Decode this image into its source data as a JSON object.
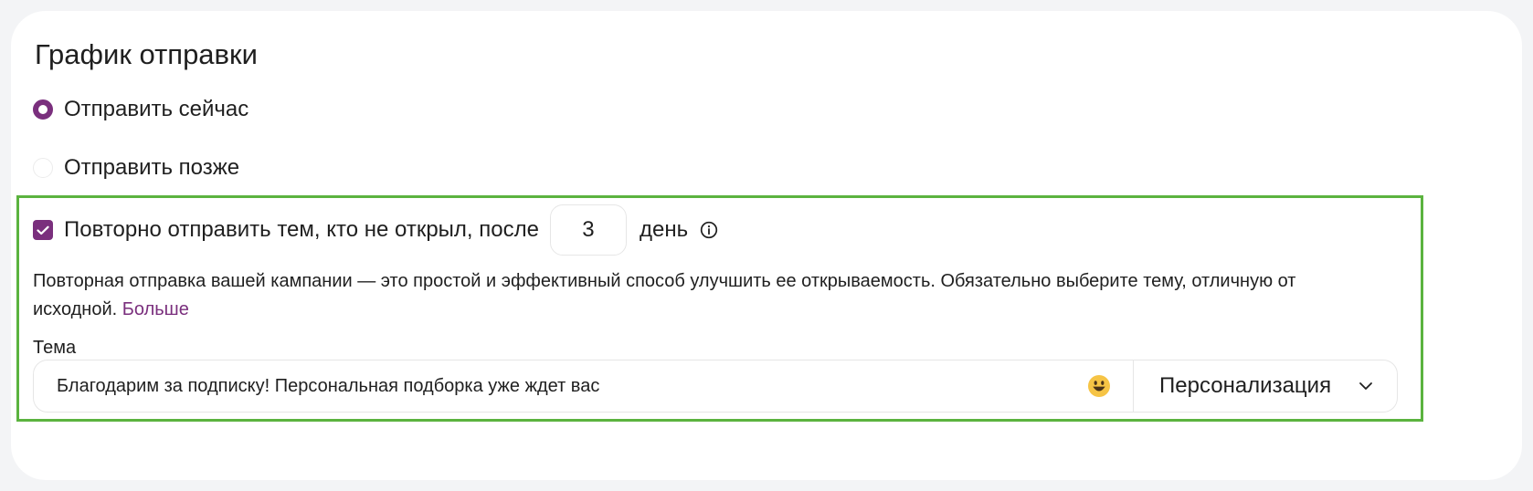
{
  "schedule": {
    "title": "График отправки",
    "options": [
      {
        "label": "Отправить сейчас",
        "selected": true
      },
      {
        "label": "Отправить позже",
        "selected": false
      }
    ]
  },
  "resend": {
    "checked": true,
    "label": "Повторно отправить тем, кто не открыл, после",
    "days_value": "3",
    "days_unit": "день",
    "info_icon": "info-circle-icon",
    "description": "Повторная отправка вашей кампании — это простой и эффективный способ улучшить ее открываемость. Обязательно выберите тему, отличную от исходной.",
    "more_link": "Больше",
    "subject_label": "Тема",
    "subject_value": "Благодарим за подписку! Персональная подборка уже ждет вас",
    "emoji_icon": "emoji-smile-icon",
    "personalization_label": "Персонализация",
    "dropdown_icon": "chevron-down-icon"
  },
  "colors": {
    "accent": "#7a2f7d",
    "highlight_border": "#5bb33f",
    "background": "#f3f4f6",
    "card": "#ffffff"
  }
}
